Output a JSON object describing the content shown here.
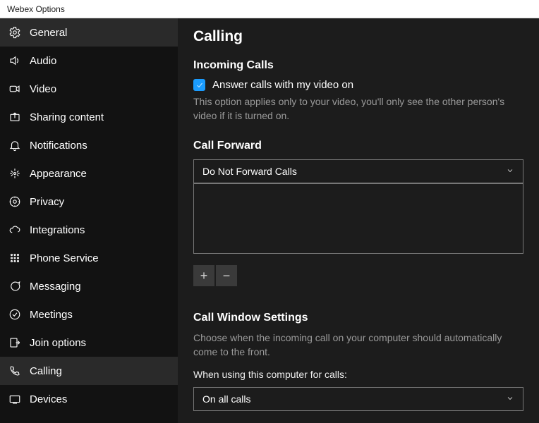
{
  "window": {
    "title": "Webex Options"
  },
  "sidebar": {
    "items": [
      {
        "label": "General",
        "icon": "gear-icon"
      },
      {
        "label": "Audio",
        "icon": "speaker-icon"
      },
      {
        "label": "Video",
        "icon": "video-icon"
      },
      {
        "label": "Sharing content",
        "icon": "share-icon"
      },
      {
        "label": "Notifications",
        "icon": "bell-icon"
      },
      {
        "label": "Appearance",
        "icon": "appearance-icon"
      },
      {
        "label": "Privacy",
        "icon": "privacy-icon"
      },
      {
        "label": "Integrations",
        "icon": "cloud-icon"
      },
      {
        "label": "Phone Service",
        "icon": "dialpad-icon"
      },
      {
        "label": "Messaging",
        "icon": "messaging-icon"
      },
      {
        "label": "Meetings",
        "icon": "meetings-icon"
      },
      {
        "label": "Join options",
        "icon": "join-icon"
      },
      {
        "label": "Calling",
        "icon": "phone-icon"
      },
      {
        "label": "Devices",
        "icon": "devices-icon"
      }
    ],
    "active_index": 12,
    "hover_index": 0
  },
  "main": {
    "title": "Calling",
    "incoming": {
      "heading": "Incoming Calls",
      "checkbox_label": "Answer calls with my video on",
      "checkbox_checked": true,
      "helper": "This option applies only to your video, you'll only see the other person's video if it is turned on."
    },
    "forward": {
      "heading": "Call Forward",
      "dropdown_value": "Do Not Forward Calls",
      "add_label": "+",
      "remove_label": "−"
    },
    "call_window": {
      "heading": "Call Window Settings",
      "helper": "Choose when the incoming call on your computer should automatically come to the front.",
      "label": "When using this computer for calls:",
      "dropdown_value": "On all calls"
    }
  }
}
